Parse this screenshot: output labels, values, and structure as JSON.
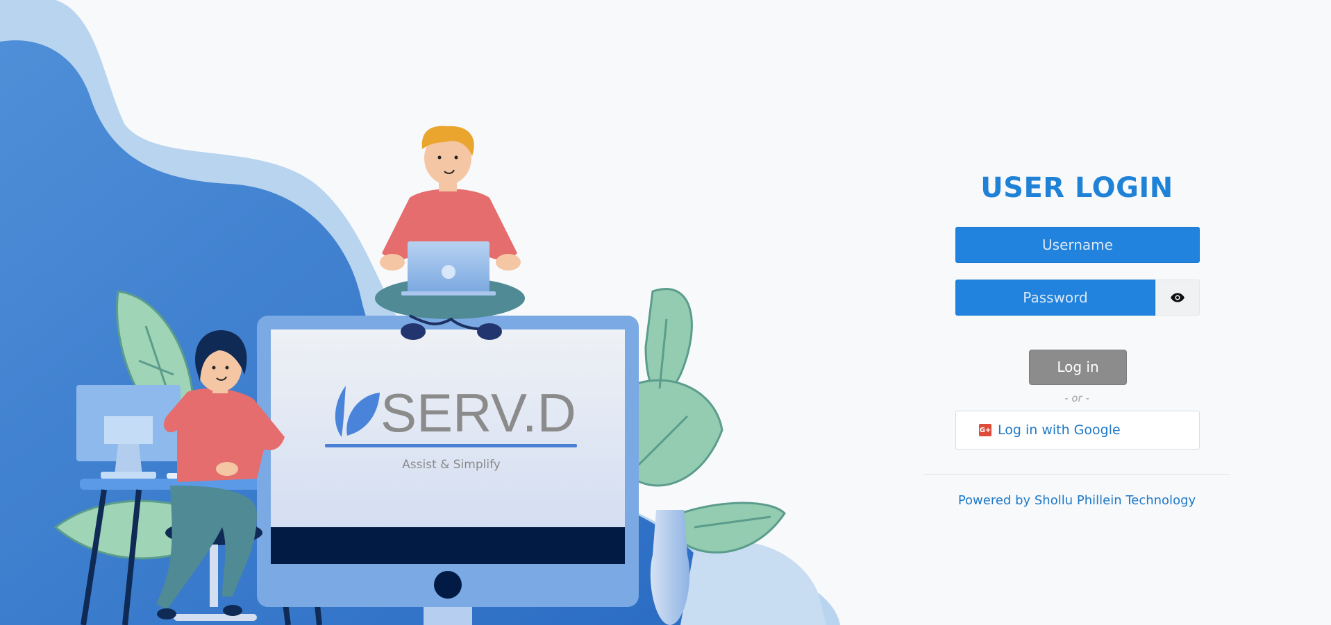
{
  "illustration": {
    "logo_text": "SERV.D",
    "tagline": "Assist & Simplify"
  },
  "login": {
    "title": "USER LOGIN",
    "username_placeholder": "Username",
    "password_placeholder": "Password",
    "login_label": "Log in",
    "or_label": "- or -",
    "google_label": "Log in with Google",
    "google_icon_text": "G+",
    "powered_by": "Powered by Shollu Phillein Technology"
  },
  "colors": {
    "accent": "#2183dd",
    "title": "#1f82d6",
    "login_button": "#8c8c8c",
    "google_red": "#dd4b39"
  },
  "icons": [
    "eye-icon",
    "google-plus-icon",
    "leaf-logo-icon"
  ]
}
